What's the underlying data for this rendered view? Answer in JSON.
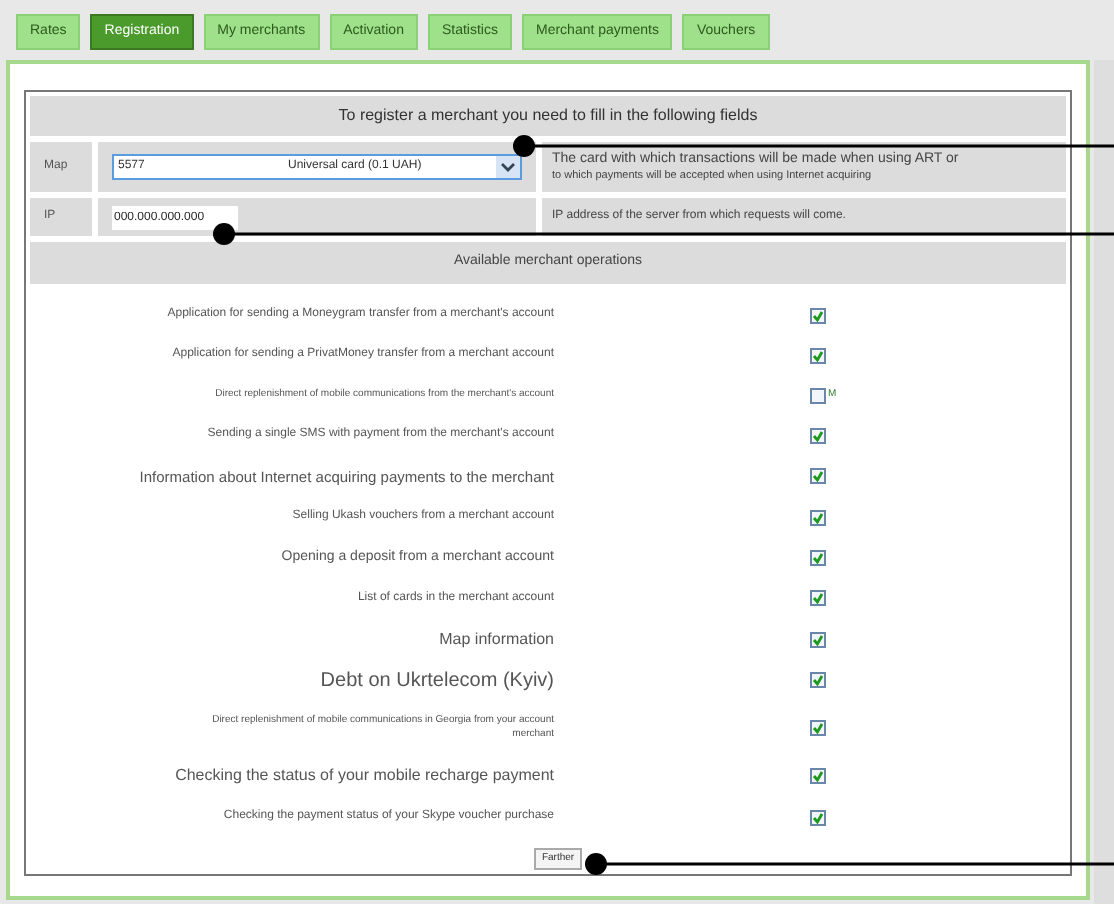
{
  "tabs": [
    {
      "label": "Rates",
      "selected": false
    },
    {
      "label": "Registration",
      "selected": true
    },
    {
      "label": "My merchants",
      "selected": false
    },
    {
      "label": "Activation",
      "selected": false
    },
    {
      "label": "Statistics",
      "selected": false
    },
    {
      "label": "Merchant payments",
      "selected": false
    },
    {
      "label": "Vouchers",
      "selected": false
    }
  ],
  "form": {
    "title": "To register a merchant you need to fill in the following fields",
    "map": {
      "label": "Map",
      "value": "5577",
      "option": "Universal card (0.1 UAH)",
      "hint": "The card with which transactions will be made when using ART or",
      "hint_2": "to which payments will be accepted when using Internet acquiring"
    },
    "ip": {
      "label": "IP",
      "value": "000.000.000.000",
      "hint": "IP address of the server from which requests will come."
    },
    "operations_title": "Available merchant operations",
    "operations": [
      {
        "label": "Application for sending a Moneygram transfer from a merchant's account",
        "checked": true
      },
      {
        "label": "Application for sending a PrivatMoney transfer from a merchant account",
        "checked": true
      },
      {
        "label": "Direct replenishment of mobile communications from the merchant's account",
        "checked": false,
        "box_text": "M"
      },
      {
        "label": "Sending a single SMS with payment from the merchant's account",
        "checked": true
      },
      {
        "label": "Information about Internet acquiring payments to the merchant",
        "checked": true
      },
      {
        "label": "Selling Ukash vouchers from a merchant account",
        "checked": true
      },
      {
        "label": "Opening a deposit from a merchant account",
        "checked": true
      },
      {
        "label": "List of cards in the merchant account",
        "checked": true
      },
      {
        "label": "Map information",
        "checked": true
      },
      {
        "label": "Debt on Ukrtelecom (Kyiv)",
        "checked": true
      },
      {
        "label": "Direct replenishment of mobile communications in Georgia from your account",
        "label_2": "merchant",
        "checked": true
      },
      {
        "label": "Checking the status of your mobile recharge payment",
        "checked": true
      },
      {
        "label": "Checking the payment status of your Skype voucher purchase",
        "checked": true
      }
    ],
    "submit": "Farther"
  }
}
